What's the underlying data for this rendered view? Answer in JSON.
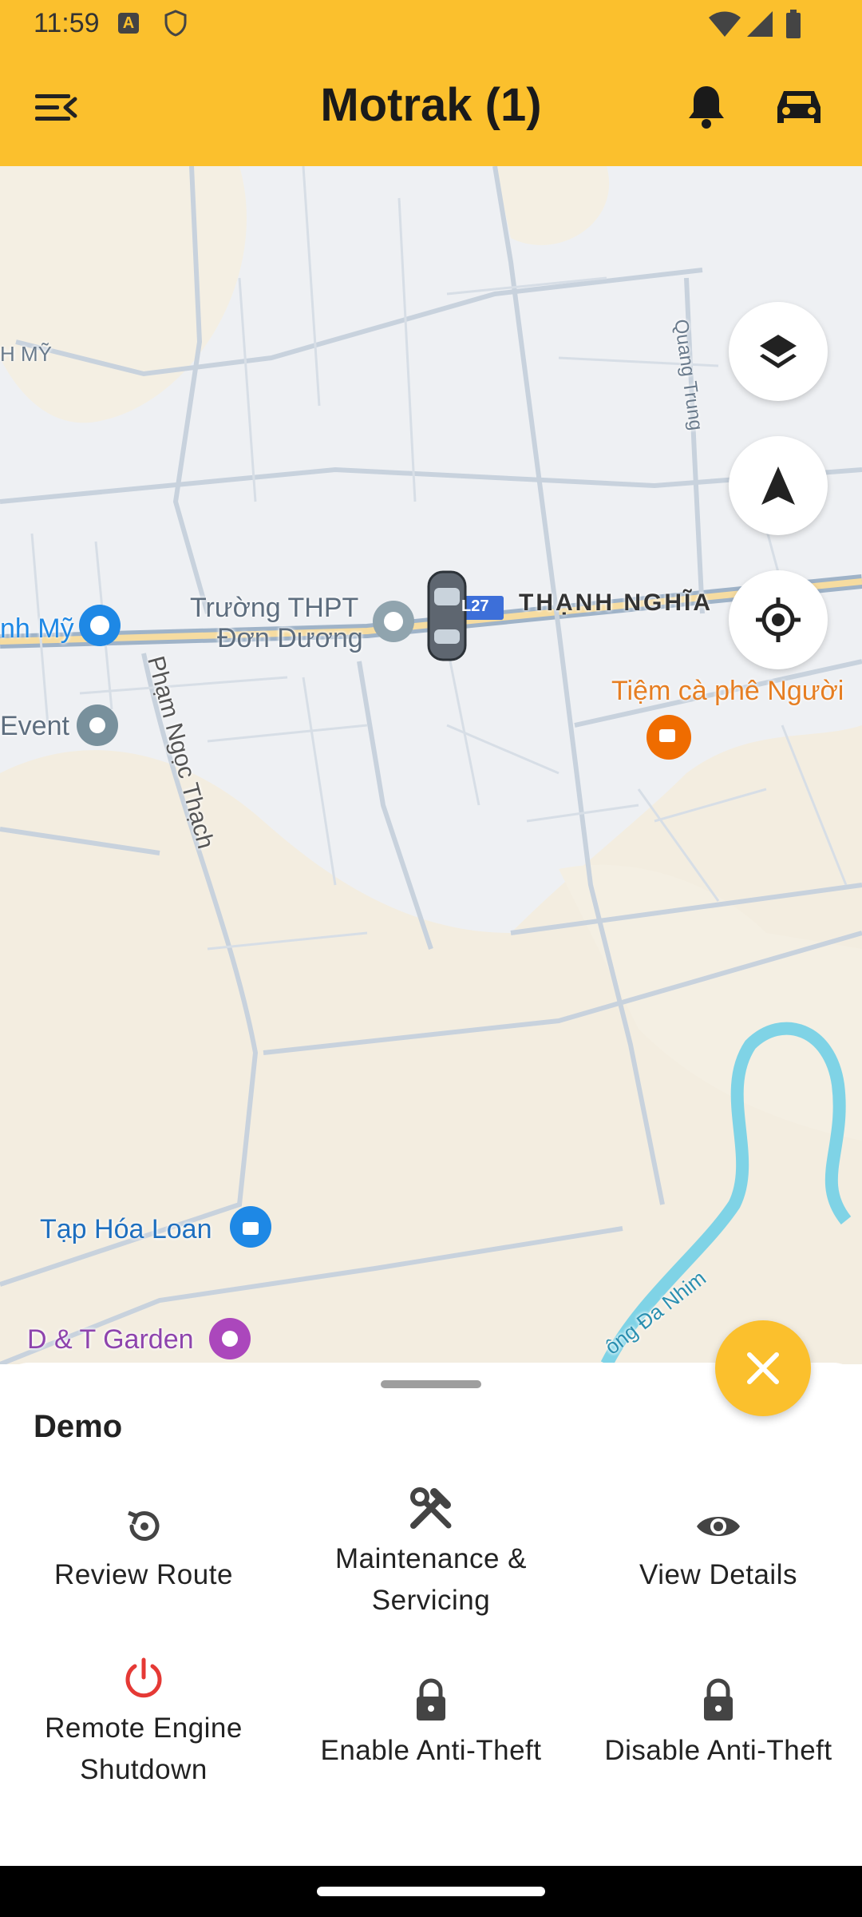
{
  "status_bar": {
    "time": "11:59"
  },
  "app_bar": {
    "title": "Motrak (1)"
  },
  "map": {
    "labels": {
      "quang_trung": "Quang Trung",
      "h_my_top": "H MỸ",
      "h_my": "nh Mỹ",
      "truong_1": "Trường THPT",
      "truong_2": "Đơn Dương",
      "route": "L27",
      "thanh_nghia": "THẠNH NGHĨA",
      "pham_ngoc_thach": "Phạm Ngọc Thạch",
      "event": "Event",
      "tiem_ca_phe": "Tiệm cà phê Người",
      "tap_hoa": "Tạp Hóa Loan",
      "dt_garden": "D & T Garden",
      "song_da_nhim": "ông Đa Nhim"
    }
  },
  "sheet": {
    "vehicle_name": "Demo",
    "actions": [
      {
        "label": "Review Route",
        "icon": "history-icon"
      },
      {
        "label": "Maintenance & Servicing",
        "icon": "tools-icon"
      },
      {
        "label": "View Details",
        "icon": "eye-icon"
      },
      {
        "label": "Remote Engine Shutdown",
        "icon": "power-icon"
      },
      {
        "label": "Enable Anti-Theft",
        "icon": "lock-icon"
      },
      {
        "label": "Disable Anti-Theft",
        "icon": "lock-icon"
      }
    ]
  },
  "colors": {
    "accent": "#FBC02D",
    "power": "#E53935",
    "map_bg": "#EEF0F3"
  }
}
